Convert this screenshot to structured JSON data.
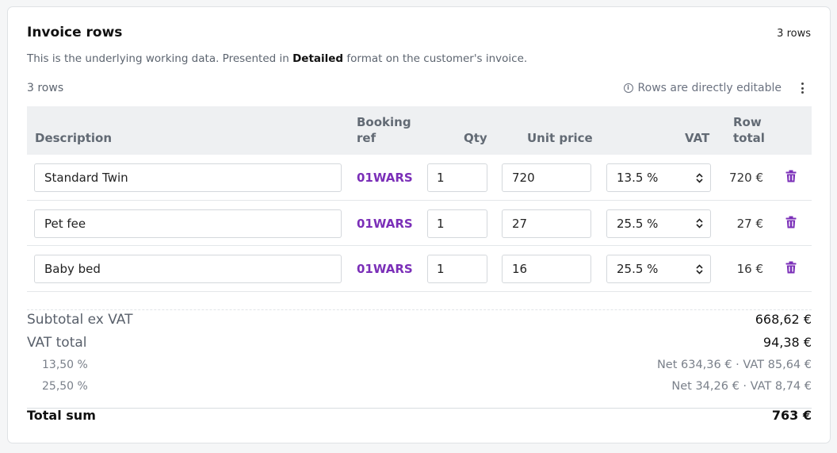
{
  "header": {
    "title": "Invoice rows",
    "row_count_badge": "3 rows",
    "subtitle_prefix": "This is the underlying working data. Presented in ",
    "subtitle_format": "Detailed",
    "subtitle_suffix": " format on the customer's invoice."
  },
  "toolbar": {
    "rows_label": "3 rows",
    "editable_note": "Rows are directly editable",
    "info_icon": "info-circle-icon",
    "menu_icon": "kebab-menu-icon"
  },
  "columns": {
    "description": "Description",
    "booking_ref_line1": "Booking",
    "booking_ref_line2": "ref",
    "qty": "Qty",
    "unit_price": "Unit price",
    "vat": "VAT",
    "row_total_line1": "Row",
    "row_total_line2": "total"
  },
  "rows": [
    {
      "description": "Standard Twin",
      "booking_ref": "01WARS",
      "qty": "1",
      "unit_price": "720",
      "vat": "13.5 %",
      "row_total": "720 €"
    },
    {
      "description": "Pet fee",
      "booking_ref": "01WARS",
      "qty": "1",
      "unit_price": "27",
      "vat": "25.5 %",
      "row_total": "27 €"
    },
    {
      "description": "Baby bed",
      "booking_ref": "01WARS",
      "qty": "1",
      "unit_price": "16",
      "vat": "25.5 %",
      "row_total": "16 €"
    }
  ],
  "summary": {
    "subtotal_label": "Subtotal ex VAT",
    "subtotal_value": "668,62 €",
    "vat_total_label": "VAT total",
    "vat_total_value": "94,38 €",
    "vat_breakdown": [
      {
        "rate": "13,50 %",
        "detail": "Net 634,36 € · VAT 85,64 €"
      },
      {
        "rate": "25,50 %",
        "detail": "Net 34,26 € · VAT 8,74 €"
      }
    ],
    "total_label": "Total sum",
    "total_value": "763 €"
  },
  "colors": {
    "accent": "#7b2fb8",
    "header_bg": "#eef0f2",
    "muted_text": "#5d6570"
  }
}
